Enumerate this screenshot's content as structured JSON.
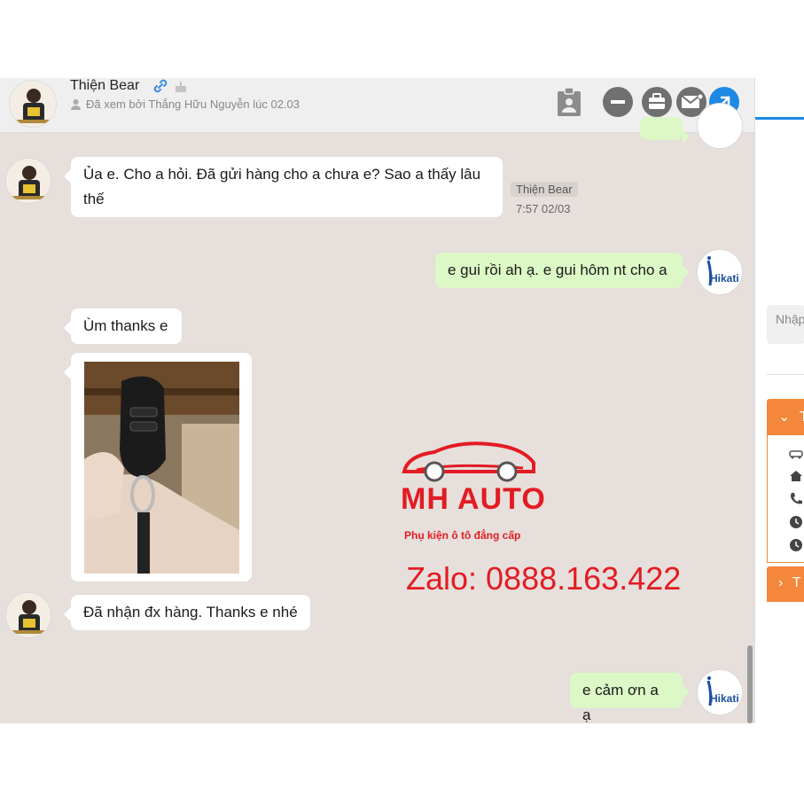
{
  "header": {
    "contact_name": "Thiện Bear",
    "seen_text": "Đã xem bởi Thắng Hữu Nguyễn lúc 02.03"
  },
  "messages": [
    {
      "id": "m1",
      "direction": "in",
      "text": "Ủa e. Cho a hỏi. Đã gửi hàng cho a chưa e? Sao a thấy lâu thế",
      "sender": "Thiện Bear",
      "time": "7:57 02/03"
    },
    {
      "id": "m2",
      "direction": "out",
      "text": "e gui rồi ah ạ. e gui hôm nt cho a"
    },
    {
      "id": "m3",
      "direction": "in",
      "text": "Ùm thanks e"
    },
    {
      "id": "m4",
      "direction": "in",
      "type": "image"
    },
    {
      "id": "m5",
      "direction": "in",
      "text": "Đã nhận đx hàng. Thanks e nhé"
    },
    {
      "id": "m6",
      "direction": "out",
      "text": "e cảm ơn a ạ"
    }
  ],
  "avatar_brand": "Hikati",
  "watermark": {
    "brand": "MH AUTO",
    "tagline": "Phụ kiện ô tô đẳng cấp",
    "zalo": "Zalo: 0888.163.422"
  },
  "right_panel": {
    "input_placeholder": "Nhập",
    "section_letter": "T",
    "accent": "#f4873c"
  },
  "colors": {
    "chat_bg": "#e6dfdb",
    "outgoing_bubble": "#dcf8c6",
    "popout_button": "#1e88e5",
    "watermark_red": "#e31b23"
  }
}
